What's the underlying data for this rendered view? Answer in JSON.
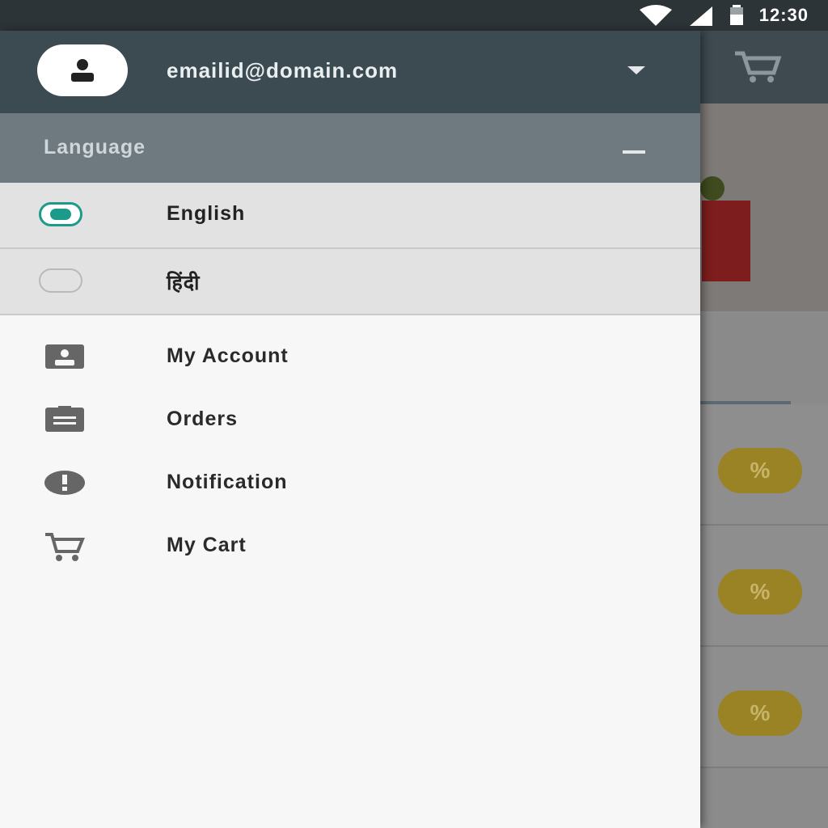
{
  "status_bar": {
    "time": "12:30"
  },
  "drawer": {
    "email": "emailid@domain.com",
    "language_section": {
      "label": "Language",
      "options": [
        {
          "label": "English",
          "selected": true
        },
        {
          "label": "हिंदी",
          "selected": false
        }
      ]
    },
    "menu": [
      {
        "label": "My Account",
        "icon": "account-box-icon"
      },
      {
        "label": "Orders",
        "icon": "orders-icon"
      },
      {
        "label": "Notification",
        "icon": "notification-icon"
      },
      {
        "label": "My Cart",
        "icon": "cart-icon"
      }
    ]
  },
  "background_app": {
    "offer_badges": [
      "%",
      "%",
      "%"
    ]
  },
  "colors": {
    "header": "#3c4a51",
    "language_header": "#6e7a80",
    "accent": "#1c9a8a",
    "badge": "#9a8324"
  }
}
